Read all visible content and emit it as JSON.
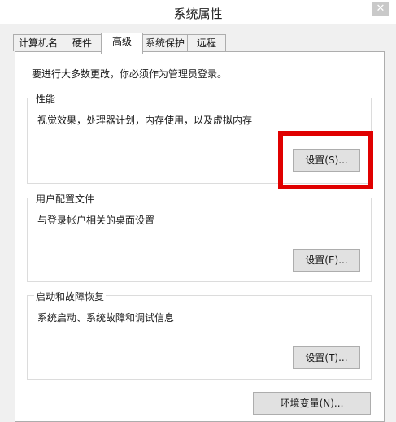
{
  "window": {
    "title": "系统属性",
    "close_label": "✕"
  },
  "tabs": [
    {
      "label": "计算机名"
    },
    {
      "label": "硬件"
    },
    {
      "label": "高级"
    },
    {
      "label": "系统保护"
    },
    {
      "label": "远程"
    }
  ],
  "active_tab": "高级",
  "notice": "要进行大多数更改，你必须作为管理员登录。",
  "groups": {
    "performance": {
      "title": "性能",
      "desc": "视觉效果，处理器计划，内存使用，以及虚拟内存",
      "button": "设置(S)..."
    },
    "user_profiles": {
      "title": "用户配置文件",
      "desc": "与登录帐户相关的桌面设置",
      "button": "设置(E)..."
    },
    "startup_recovery": {
      "title": "启动和故障恢复",
      "desc": "系统启动、系统故障和调试信息",
      "button": "设置(T)..."
    }
  },
  "env_button": "环境变量(N)...",
  "highlight_color": "#e00000"
}
